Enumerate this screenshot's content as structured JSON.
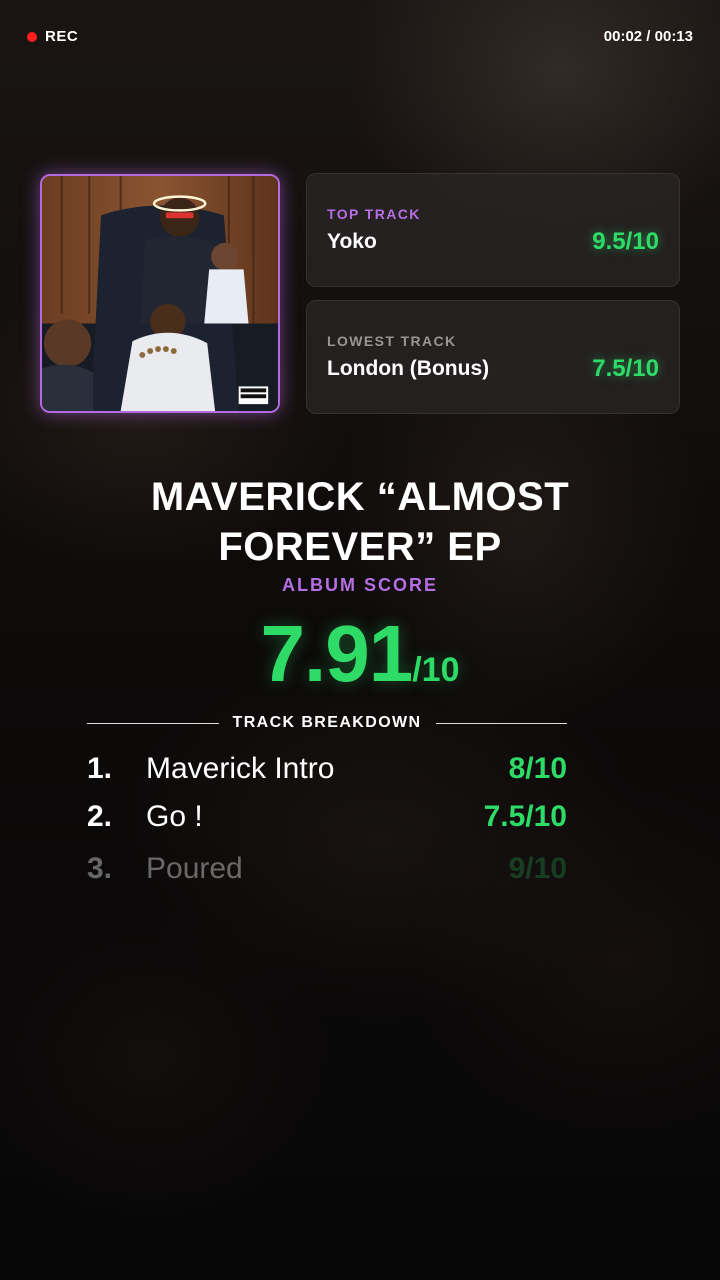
{
  "recording": {
    "label": "REC",
    "timer": "00:02 / 00:13"
  },
  "top_track": {
    "label": "TOP TRACK",
    "name": "Yoko",
    "score": "9.5/10"
  },
  "lowest_track": {
    "label": "LOWEST TRACK",
    "name": "London (Bonus)",
    "score": "7.5/10"
  },
  "album": {
    "title": "MAVERICK “ALMOST FOREVER” EP",
    "score_label": "ALBUM SCORE",
    "score": "7.91",
    "score_denominator": "/10"
  },
  "breakdown": {
    "heading": "TRACK BREAKDOWN",
    "tracks": [
      {
        "num": "1.",
        "name": "Maverick Intro",
        "score": "8/10"
      },
      {
        "num": "2.",
        "name": "Go !",
        "score": "7.5/10"
      },
      {
        "num": "3.",
        "name": "Poured",
        "score": "9/10"
      }
    ]
  },
  "colors": {
    "accent_purple": "#b56ee3",
    "score_green": "#2edb67",
    "rec_red": "#ff1e1e"
  },
  "icons": {
    "rec": "record-dot-icon",
    "art": "album-cover-image"
  }
}
